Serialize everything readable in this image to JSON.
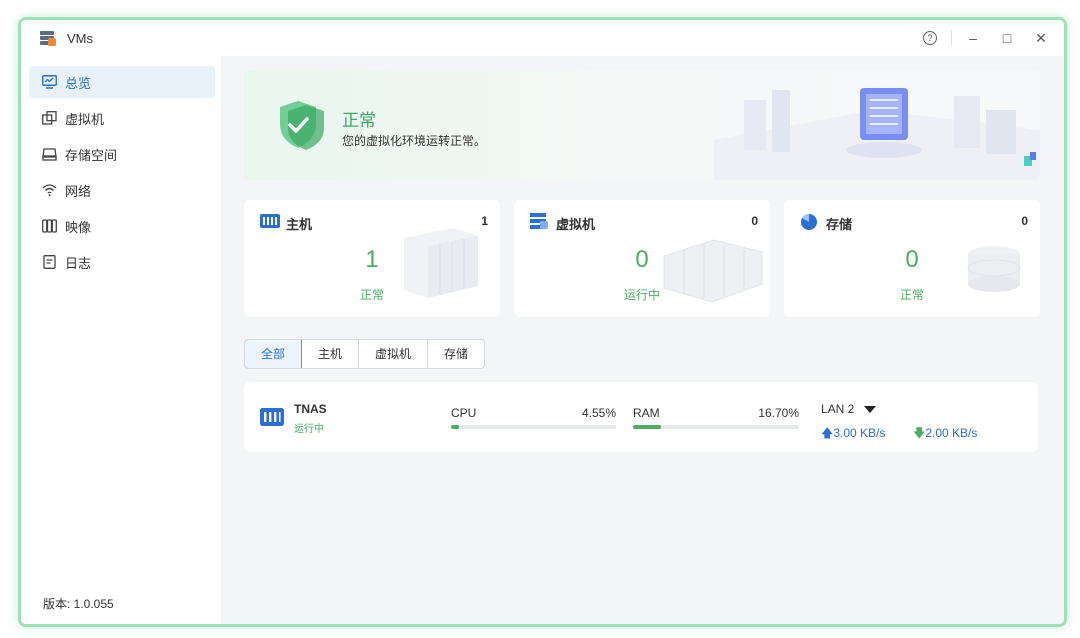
{
  "app": {
    "title": "VMs"
  },
  "window_controls": {
    "help": "?",
    "minimize": "–",
    "maximize": "□",
    "close": "✕"
  },
  "sidebar": {
    "items": [
      {
        "label": "总览",
        "icon": "monitor-icon",
        "active": true
      },
      {
        "label": "虚拟机",
        "icon": "windows-icon",
        "active": false
      },
      {
        "label": "存储空间",
        "icon": "drive-icon",
        "active": false
      },
      {
        "label": "网络",
        "icon": "wifi-icon",
        "active": false
      },
      {
        "label": "映像",
        "icon": "disc-icon",
        "active": false
      },
      {
        "label": "日志",
        "icon": "document-icon",
        "active": false
      }
    ],
    "version": "版本: 1.0.055"
  },
  "banner": {
    "status": "正常",
    "description": "您的虚拟化环境运转正常。"
  },
  "cards": [
    {
      "title": "主机",
      "count": "1",
      "big": "1",
      "sub": "正常",
      "icon": "server-icon"
    },
    {
      "title": "虚拟机",
      "count": "0",
      "big": "0",
      "sub": "运行中",
      "icon": "vm-stack-icon"
    },
    {
      "title": "存储",
      "count": "0",
      "big": "0",
      "sub": "正常",
      "icon": "pie-icon"
    }
  ],
  "tabs": [
    "全部",
    "主机",
    "虚拟机",
    "存储"
  ],
  "host": {
    "name": "TNAS",
    "status": "运行中",
    "cpu_label": "CPU",
    "cpu_value": "4.55%",
    "cpu_fraction": 0.0455,
    "ram_label": "RAM",
    "ram_value": "16.70%",
    "ram_fraction": 0.167,
    "net_label": "LAN 2",
    "net_up": "3.00 KB/s",
    "net_down": "2.00 KB/s"
  },
  "colors": {
    "accent": "#2b6fd6",
    "ok": "#4aae62",
    "border_glow": "#9fe0b8"
  }
}
